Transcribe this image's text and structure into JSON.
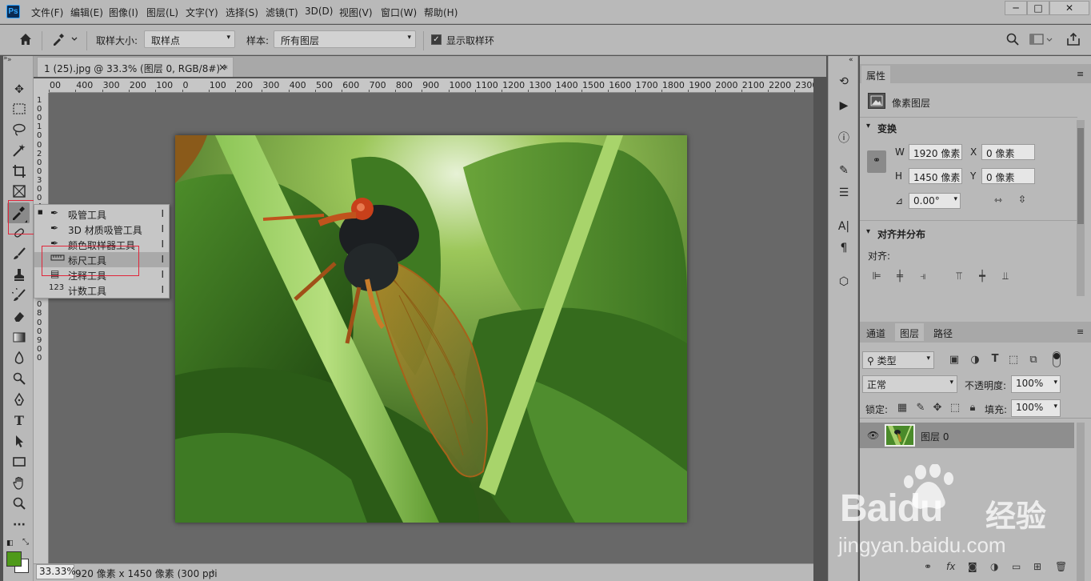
{
  "menubar": {
    "items": [
      "文件(F)",
      "编辑(E)",
      "图像(I)",
      "图层(L)",
      "文字(Y)",
      "选择(S)",
      "滤镜(T)",
      "3D(D)",
      "视图(V)",
      "窗口(W)",
      "帮助(H)"
    ],
    "logo": "Ps",
    "win_min": "─",
    "win_max": "□",
    "win_close": "✕"
  },
  "options": {
    "sample_size_label": "取样大小:",
    "sample_size_value": "取样点",
    "sample_label": "样本:",
    "sample_value": "所有图层",
    "show_ring_label": "显示取样环",
    "show_ring_checked": true
  },
  "document": {
    "tab_title": "1 (25).jpg @ 33.3% (图层 0, RGB/8#) *",
    "close": "×",
    "zoom": "33.33%",
    "status": "920 像素 x 1450 像素 (300 ppi",
    "status_arrow": "›"
  },
  "ruler": {
    "h_labels": [
      "00",
      "400",
      "300",
      "200",
      "100",
      "0",
      "100",
      "200",
      "300",
      "400",
      "500",
      "600",
      "700",
      "800",
      "900",
      "1000",
      "1100",
      "1200",
      "1300",
      "1400",
      "1500",
      "1600",
      "1700",
      "1800",
      "1900",
      "2000",
      "2100",
      "2200",
      "2300"
    ],
    "v_labels": [
      "1",
      "0",
      "0",
      "1",
      "0",
      "0",
      "2",
      "0",
      "0",
      "3",
      "0",
      "0",
      "4",
      "0",
      "0",
      "5",
      "0",
      "0",
      "6",
      "0",
      "0",
      "7",
      "0",
      "0",
      "8",
      "0",
      "0",
      "9",
      "0",
      "0"
    ]
  },
  "flyout": {
    "items": [
      {
        "icon": "eyedropper-icon",
        "glyph": "✒",
        "name": "吸管工具",
        "key": "I",
        "active": true
      },
      {
        "icon": "eyedropper-3d-icon",
        "glyph": "✒",
        "name": "3D 材质吸管工具",
        "key": "I",
        "active": false
      },
      {
        "icon": "color-sampler-icon",
        "glyph": "✒",
        "name": "颜色取样器工具",
        "key": "I",
        "active": false
      },
      {
        "icon": "ruler-icon",
        "glyph": "▭",
        "name": "标尺工具",
        "key": "I",
        "active": false
      },
      {
        "icon": "note-icon",
        "glyph": "▤",
        "name": "注释工具",
        "key": "I",
        "active": false
      },
      {
        "icon": "count-icon",
        "glyph": "123",
        "name": "计数工具",
        "key": "I",
        "active": false
      }
    ],
    "bullet": "■"
  },
  "properties": {
    "tab": "属性",
    "kind": "像素图层",
    "transform_title": "变换",
    "w_label": "W",
    "w_value": "1920 像素",
    "h_label": "H",
    "h_value": "1450 像素",
    "x_label": "X",
    "x_value": "0 像素",
    "y_label": "Y",
    "y_value": "0 像素",
    "angle_value": "0.00°",
    "align_title": "对齐并分布",
    "align_label": "对齐:"
  },
  "layers": {
    "tabs": [
      "通道",
      "图层",
      "路径"
    ],
    "active_tab": 1,
    "filter_value": "类型",
    "blend_mode": "正常",
    "opacity_label": "不透明度:",
    "opacity_value": "100%",
    "lock_label": "锁定:",
    "fill_label": "填充:",
    "fill_value": "100%",
    "layer_name": "图层 0"
  },
  "watermark": {
    "brand": "Baidu",
    "brand2": "经验",
    "url": "jingyan.baidu.com"
  },
  "colors": {
    "foreground": "#4f9a1a",
    "background": "#ffffff",
    "highlight": "#e0263a"
  }
}
